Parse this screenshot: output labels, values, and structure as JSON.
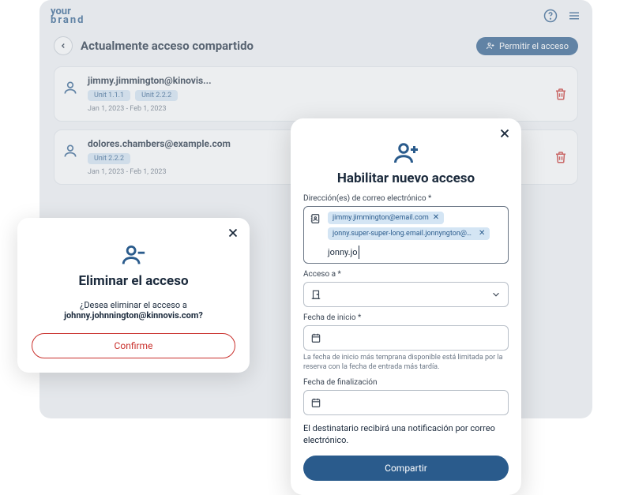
{
  "brand": {
    "line1": "your",
    "line2": "brand"
  },
  "page": {
    "title": "Actualmente acceso compartido",
    "permit_label": "Permitir el acceso"
  },
  "access_list": [
    {
      "email": "jimmy.jimmington@kinovis...",
      "units": [
        "Unit 1.1.1",
        "Unit 2.2.2"
      ],
      "dates": "Jan 1, 2023 - Feb 1, 2023"
    },
    {
      "email": "dolores.chambers@example.com",
      "units": [
        "Unit 2.2.2"
      ],
      "dates": "Jan 1, 2023 - Feb 1, 2023"
    }
  ],
  "delete_dialog": {
    "title": "Eliminar el acceso",
    "question": "¿Desea eliminar el acceso a",
    "email": "johnny.johnnington@kinnovis.com",
    "q_suffix": "?",
    "confirm_label": "Confirme"
  },
  "enable_dialog": {
    "title": "Habilitar nuevo acceso",
    "email_label": "Dirección(es) de correo electrónico *",
    "email_chips": [
      "jimmy.jimmington@email.com",
      "jonny.super-super-long.email.jonnyngton@kinnovis..."
    ],
    "email_typing": "jonny.jo",
    "access_to_label": "Acceso a *",
    "start_label": "Fecha de inicio *",
    "start_helper": "La fecha de inicio más temprana disponible está limitada por la reserva con la fecha de entrada más tardía.",
    "end_label": "Fecha de finalización",
    "note": "El destinatario recibirá una notificación por correo electrónico.",
    "share_label": "Compartir"
  }
}
